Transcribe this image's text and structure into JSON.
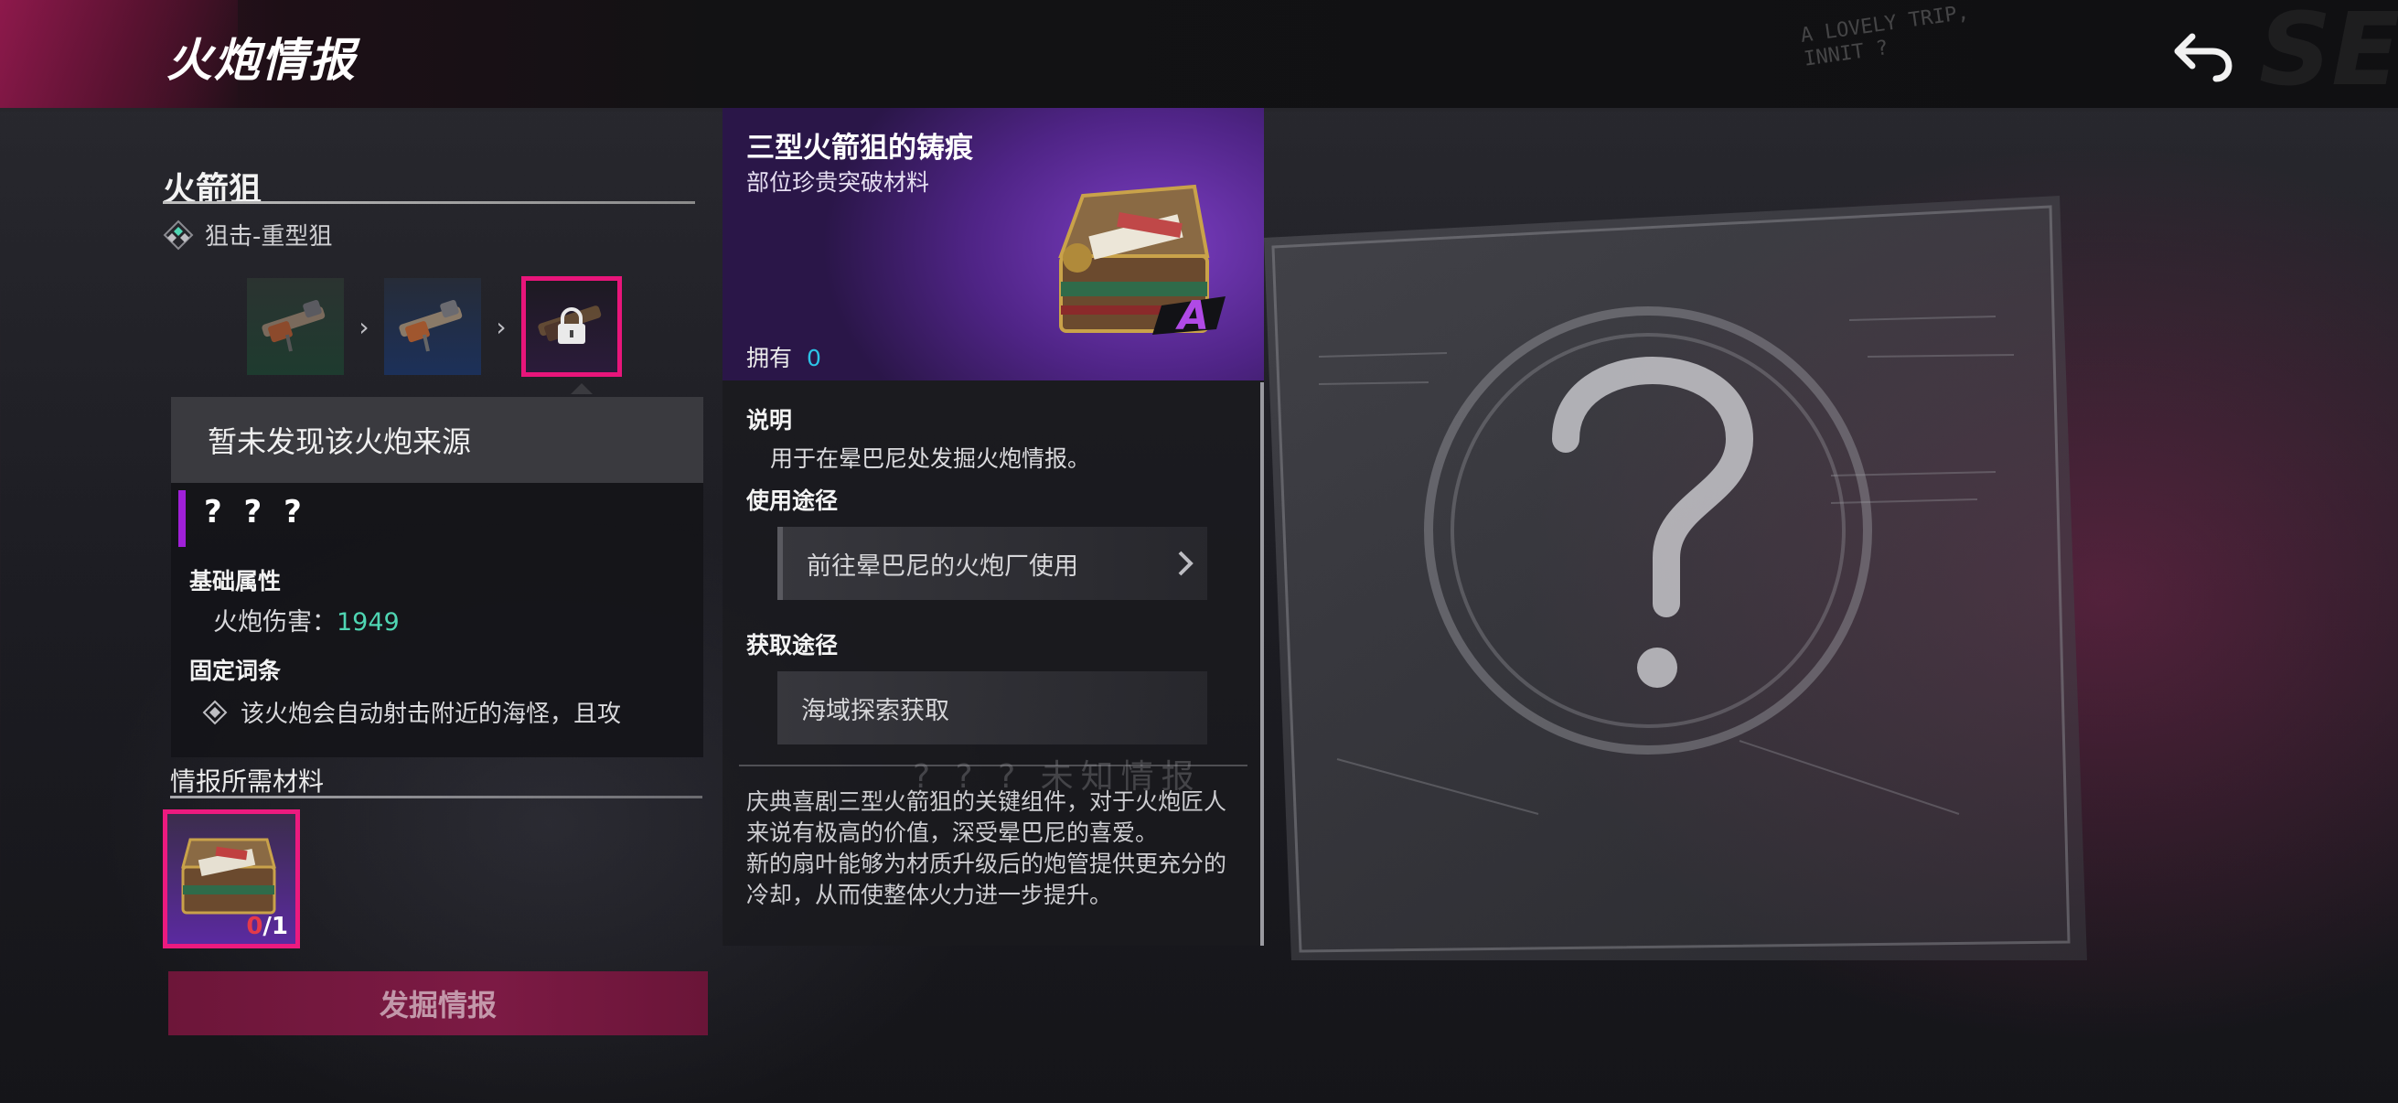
{
  "header": {
    "title": "火炮情报",
    "handwriting": [
      "A LOVELY TRIP,",
      "INNIT ?"
    ],
    "corner_text": "SE"
  },
  "cannon": {
    "name": "火箭狙",
    "class_label": "狙击-重型狙",
    "source_note": "暂未发现该火炮来源",
    "mystery_name": "? ? ?",
    "base_attr_title": "基础属性",
    "damage_label": "火炮伤害：",
    "damage_value": "1949",
    "fixed_affix_title": "固定词条",
    "affix_text": "该火炮会自动射击附近的海怪，且攻"
  },
  "materials": {
    "title": "情报所需材料",
    "have": "0",
    "need": "/1"
  },
  "dig_button": "发掘情报",
  "item": {
    "name": "三型火箭狙的铸痕",
    "subtitle": "部位珍贵突破材料",
    "own_label": "拥有",
    "own_value": "0",
    "rarity": "A",
    "desc_title": "说明",
    "desc_text": "用于在晕巴尼处发掘火炮情报。",
    "use_title": "使用途径",
    "use_route": "前往晕巴尼的火炮厂使用",
    "get_title": "获取途径",
    "get_route": "海域探索获取",
    "ghost_text": "? ? ?   未知情报",
    "lore_1": "庆典喜剧三型火箭狙的关键组件，对于火炮匠人来说有极高的价值，深受晕巴尼的喜爱。",
    "lore_2": "新的扇叶能够为材质升级后的炮管提供更充分的冷却，从而使整体火力进一步提升。"
  },
  "colors": {
    "accent_pink": "#e8157a",
    "accent_purple": "#a020d8",
    "value_teal": "#4fd6b3",
    "value_cyan": "#2cc3e6"
  }
}
